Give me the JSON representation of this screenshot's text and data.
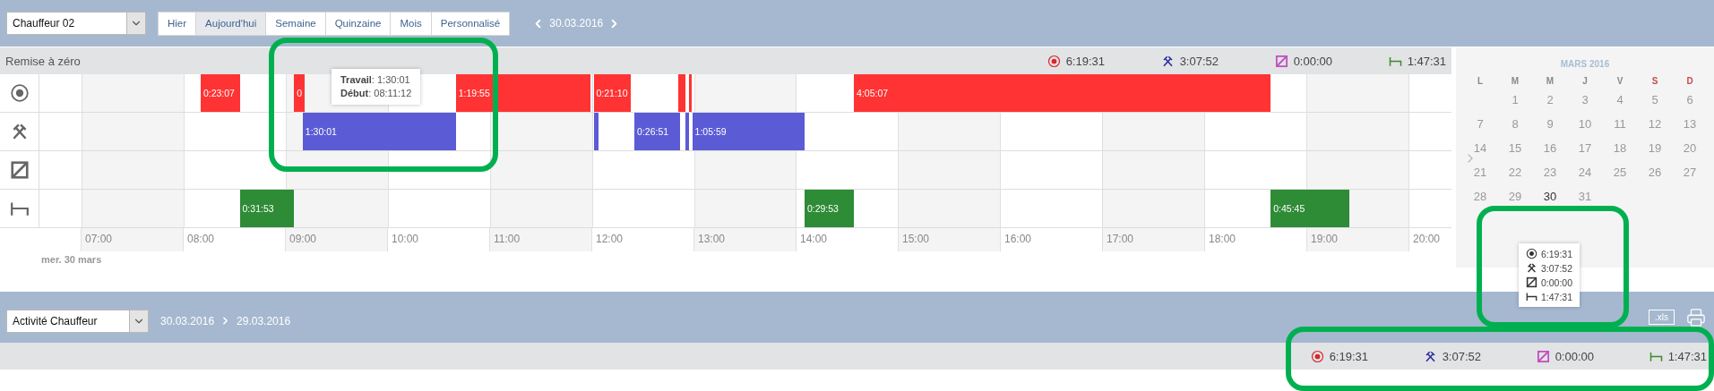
{
  "driver_select": {
    "value": "Chauffeur 02"
  },
  "period_tabs": [
    {
      "label": "Hier",
      "selected": false
    },
    {
      "label": "Aujourd'hui",
      "selected": true
    },
    {
      "label": "Semaine",
      "selected": false
    },
    {
      "label": "Quinzaine",
      "selected": false
    },
    {
      "label": "Mois",
      "selected": false
    },
    {
      "label": "Personnalisé",
      "selected": false
    }
  ],
  "date_nav": {
    "date": "30.03.2016"
  },
  "timeline": {
    "title": "Remise à zéro",
    "totals": [
      {
        "kind": "driving",
        "color": "#d9262b",
        "value": "6:19:31"
      },
      {
        "kind": "work",
        "color": "#2e2e9e",
        "value": "3:07:52"
      },
      {
        "kind": "available",
        "color": "#c050c0",
        "value": "0:00:00"
      },
      {
        "kind": "rest",
        "color": "#3c8a2e",
        "value": "1:47:31"
      }
    ],
    "rows": [
      {
        "kind": "driving",
        "bars": [
          {
            "kind": "labeled",
            "label": "0:23:07"
          },
          {
            "kind": "labeled",
            "label": "0"
          },
          {
            "kind": "labeled",
            "label": "1:19:55"
          },
          {
            "kind": "labeled",
            "label": "0:21:10"
          },
          {
            "kind": "sliver"
          },
          {
            "kind": "sliver"
          },
          {
            "kind": "labeled",
            "label": "4:05:07"
          }
        ]
      },
      {
        "kind": "work",
        "bars": [
          {
            "kind": "labeled",
            "label": "1:30:01"
          },
          {
            "kind": "sliver"
          },
          {
            "kind": "labeled",
            "label": "0:26:51"
          },
          {
            "kind": "sliver"
          },
          {
            "kind": "labeled",
            "label": "1:05:59"
          }
        ]
      },
      {
        "kind": "available"
      },
      {
        "kind": "rest",
        "bars": [
          {
            "kind": "labeled",
            "label": "0:31:53"
          },
          {
            "kind": "labeled",
            "label": "0:29:53"
          },
          {
            "kind": "labeled",
            "label": "0:45:45"
          }
        ]
      }
    ],
    "hours": [
      "07:00",
      "08:00",
      "09:00",
      "10:00",
      "11:00",
      "12:00",
      "13:00",
      "14:00",
      "15:00",
      "16:00",
      "17:00",
      "18:00",
      "19:00",
      "20:00"
    ],
    "day_label": "mer. 30 mars",
    "tooltip": {
      "lines": [
        "**Travail**: 1:30:01",
        "**Début**: 08:11:12"
      ]
    }
  },
  "calendar": {
    "title": "MARS 2016",
    "weekdays": [
      {
        "label": "L",
        "weekend": false
      },
      {
        "label": "M",
        "weekend": false
      },
      {
        "label": "M",
        "weekend": false
      },
      {
        "label": "J",
        "weekend": false
      },
      {
        "label": "V",
        "weekend": false
      },
      {
        "label": "S",
        "weekend": true
      },
      {
        "label": "D",
        "weekend": true
      }
    ],
    "days": [
      {
        "label": "1",
        "selected": false
      },
      {
        "label": "2",
        "selected": false
      },
      {
        "label": "3",
        "selected": false
      },
      {
        "label": "4",
        "selected": false
      },
      {
        "label": "5",
        "selected": false
      },
      {
        "label": "6",
        "selected": false
      },
      {
        "label": "7",
        "selected": false
      },
      {
        "label": "8",
        "selected": false
      },
      {
        "label": "9",
        "selected": false
      },
      {
        "label": "10",
        "selected": false
      },
      {
        "label": "11",
        "selected": false
      },
      {
        "label": "12",
        "selected": false
      },
      {
        "label": "13",
        "selected": false
      },
      {
        "label": "14",
        "selected": false
      },
      {
        "label": "15",
        "selected": false
      },
      {
        "label": "16",
        "selected": false
      },
      {
        "label": "17",
        "selected": false
      },
      {
        "label": "18",
        "selected": false
      },
      {
        "label": "19",
        "selected": false
      },
      {
        "label": "20",
        "selected": false
      },
      {
        "label": "21",
        "selected": false
      },
      {
        "label": "22",
        "selected": false
      },
      {
        "label": "23",
        "selected": false
      },
      {
        "label": "24",
        "selected": false
      },
      {
        "label": "25",
        "selected": false
      },
      {
        "label": "26",
        "selected": false
      },
      {
        "label": "27",
        "selected": false
      },
      {
        "label": "28",
        "selected": false
      },
      {
        "label": "29",
        "selected": false
      },
      {
        "label": "30",
        "selected": true
      },
      {
        "label": "31",
        "selected": false
      }
    ],
    "popup": {
      "totals": [
        {
          "kind": "driving",
          "value": "6:19:31"
        },
        {
          "kind": "work",
          "value": "3:07:52"
        },
        {
          "kind": "available",
          "value": "0:00:00"
        },
        {
          "kind": "rest",
          "value": "1:47:31"
        }
      ]
    }
  },
  "report": {
    "select": {
      "value": "Activité Chauffeur"
    },
    "date_from": "30.03.2016",
    "date_to": "29.03.2016",
    "export_button": ".xls",
    "totals": [
      {
        "kind": "driving",
        "color": "#d9262b",
        "value": "6:19:31"
      },
      {
        "kind": "work",
        "color": "#2e2e9e",
        "value": "3:07:52"
      },
      {
        "kind": "available",
        "color": "#c050c0",
        "value": "0:00:00"
      },
      {
        "kind": "rest",
        "color": "#3c8a2e",
        "value": "1:47:31"
      }
    ]
  }
}
